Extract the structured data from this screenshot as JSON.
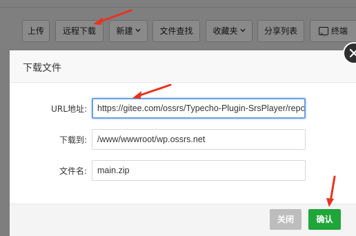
{
  "toolbar": {
    "buttons": [
      {
        "label": "上传"
      },
      {
        "label": "远程下载"
      },
      {
        "label": "新建"
      },
      {
        "label": "文件查找"
      },
      {
        "label": "收藏夹"
      },
      {
        "label": "分享列表"
      },
      {
        "label": "终端"
      }
    ]
  },
  "dialog": {
    "title": "下载文件",
    "url_label": "URL地址:",
    "url_value": "https://gitee.com/ossrs/Typecho-Plugin-SrsPlayer/reposit",
    "dest_label": "下载到:",
    "dest_value": "/www/wwwroot/wp.ossrs.net",
    "filename_label": "文件名:",
    "filename_value": "main.zip",
    "close_label": "关闭",
    "confirm_label": "确认"
  },
  "colors": {
    "confirm": "#20a53a",
    "annotation": "#e8331f",
    "focus_border": "#6aa0e0"
  }
}
